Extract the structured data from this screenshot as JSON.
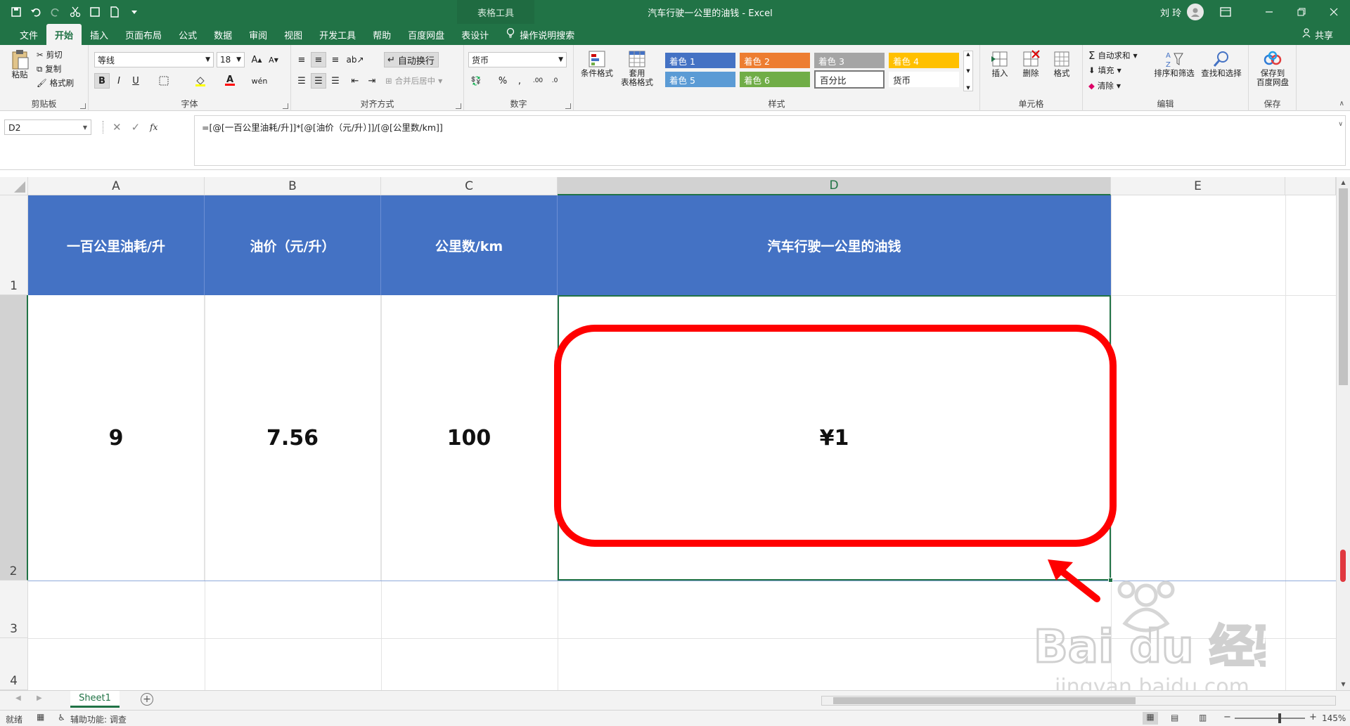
{
  "titlebar": {
    "context_tab": "表格工具",
    "doc_title": "汽车行驶一公里的油钱 - Excel",
    "user_name": "刘 玲"
  },
  "tabs": [
    {
      "label": "文件"
    },
    {
      "label": "开始",
      "active": true
    },
    {
      "label": "插入"
    },
    {
      "label": "页面布局"
    },
    {
      "label": "公式"
    },
    {
      "label": "数据"
    },
    {
      "label": "审阅"
    },
    {
      "label": "视图"
    },
    {
      "label": "开发工具"
    },
    {
      "label": "帮助"
    },
    {
      "label": "百度网盘"
    },
    {
      "label": "表设计"
    }
  ],
  "tell_me": "操作说明搜索",
  "share": "共享",
  "ribbon": {
    "clipboard": {
      "label": "剪贴板",
      "paste": "粘贴",
      "cut": "剪切",
      "copy": "复制",
      "format_painter": "格式刷"
    },
    "font": {
      "label": "字体",
      "family": "等线",
      "size": "18",
      "bold": "B",
      "italic": "I",
      "underline": "U"
    },
    "alignment": {
      "label": "对齐方式",
      "wrap_text": "自动换行",
      "merge_center": "合并后居中"
    },
    "number": {
      "label": "数字",
      "format": "货币"
    },
    "styles": {
      "label": "样式",
      "conditional": "条件格式",
      "table_format_1": "套用",
      "table_format_2": "表格格式",
      "cells": [
        {
          "text": "着色 1",
          "color": "#4472c4"
        },
        {
          "text": "着色 2",
          "color": "#ed7d31"
        },
        {
          "text": "着色 3",
          "color": "#a5a5a5"
        },
        {
          "text": "着色 4",
          "color": "#ffc000"
        },
        {
          "text": "着色 5",
          "color": "#5b9bd5"
        },
        {
          "text": "着色 6",
          "color": "#70ad47"
        },
        {
          "text": "百分比",
          "color": "#ffffff"
        },
        {
          "text": "货币",
          "color": "#ffffff"
        }
      ]
    },
    "cells_group": {
      "label": "单元格",
      "insert": "插入",
      "delete": "删除",
      "format": "格式"
    },
    "editing": {
      "label": "编辑",
      "autosum": "自动求和",
      "fill": "填充",
      "clear": "清除",
      "sort_filter": "排序和筛选",
      "find_select": "查找和选择"
    },
    "save": {
      "label": "保存",
      "save_1": "保存到",
      "save_2": "百度网盘"
    }
  },
  "formula_bar": {
    "name_box": "D2",
    "formula": "=[@[一百公里油耗/升]]*[@[油价（元/升）]]/[@[公里数/km]]"
  },
  "columns": [
    "A",
    "B",
    "C",
    "D",
    "E"
  ],
  "rows": [
    "1",
    "2",
    "3",
    "4"
  ],
  "table": {
    "headers": [
      "一百公里油耗/升",
      "油价（元/升）",
      "公里数/km",
      "汽车行驶一公里的油钱"
    ],
    "row2": [
      "9",
      "7.56",
      "100",
      "¥1"
    ]
  },
  "sheet_tab": "Sheet1",
  "status": {
    "ready": "就绪",
    "accessibility": "辅助功能: 调查",
    "zoom": "145%"
  },
  "watermark": {
    "brand": "Bai du 经验",
    "url": "jingyan.baidu.com"
  },
  "colors": {
    "excel_green": "#217346",
    "table_header": "#4472c4",
    "annotation_red": "#ff0000"
  }
}
